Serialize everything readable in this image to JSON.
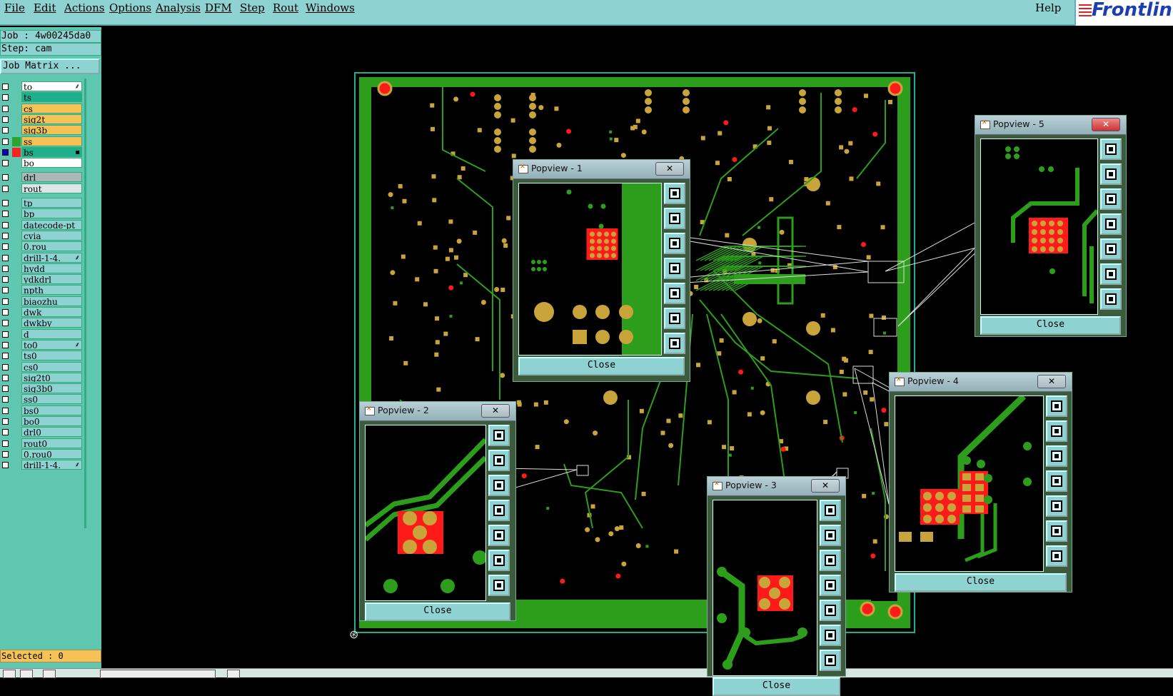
{
  "menu": {
    "items": [
      "File",
      "Edit",
      "Actions",
      "Options",
      "Analysis",
      "DFM",
      "Step",
      "Rout",
      "Windows"
    ],
    "help": "Help",
    "logo": "Frontline"
  },
  "job": {
    "job_label": "Job : 4w00245da0",
    "step_label": "Step: cam",
    "matrix_button": "Job Matrix ..."
  },
  "layers": [
    {
      "name": "to",
      "color": "#ffffff",
      "icon": "⸙"
    },
    {
      "name": "ts",
      "color": "#1fae8e",
      "icon": ""
    },
    {
      "name": "cs",
      "color": "#f6c155",
      "icon": ""
    },
    {
      "name": "sig2t",
      "color": "#f6c155",
      "icon": ""
    },
    {
      "name": "sig3b",
      "color": "#f6c155",
      "icon": ""
    },
    {
      "name": "ss",
      "color": "#f6c155",
      "icon": "",
      "mark": "#2da52d"
    },
    {
      "name": "bs",
      "color": "#1fae8e",
      "icon": "▪",
      "mark": "#ff2020",
      "active": true
    },
    {
      "name": "bo",
      "color": "#ffffff",
      "icon": ""
    },
    {
      "name": "drl",
      "color": "#aab8b8",
      "icon": "",
      "gap": true
    },
    {
      "name": "rout",
      "color": "#dde6e6",
      "icon": ""
    },
    {
      "name": "tp",
      "color": "#8fd2d2",
      "icon": "",
      "gap": true
    },
    {
      "name": "bp",
      "color": "#8fd2d2",
      "icon": ""
    },
    {
      "name": "datecode-pt",
      "color": "#8fd2d2",
      "icon": ""
    },
    {
      "name": "cvia",
      "color": "#8fd2d2",
      "icon": ""
    },
    {
      "name": "0.rou",
      "color": "#8fd2d2",
      "icon": ""
    },
    {
      "name": "drill-1-4.",
      "color": "#8fd2d2",
      "icon": "⸙"
    },
    {
      "name": "hydd",
      "color": "#8fd2d2",
      "icon": ""
    },
    {
      "name": "ydkdrl",
      "color": "#8fd2d2",
      "icon": ""
    },
    {
      "name": "npth",
      "color": "#8fd2d2",
      "icon": ""
    },
    {
      "name": "biaozhu",
      "color": "#8fd2d2",
      "icon": ""
    },
    {
      "name": "dwk",
      "color": "#8fd2d2",
      "icon": ""
    },
    {
      "name": "dwkby",
      "color": "#8fd2d2",
      "icon": ""
    },
    {
      "name": "d",
      "color": "#8fd2d2",
      "icon": ""
    },
    {
      "name": "to0",
      "color": "#8fd2d2",
      "icon": "⸙"
    },
    {
      "name": "ts0",
      "color": "#8fd2d2",
      "icon": ""
    },
    {
      "name": "cs0",
      "color": "#8fd2d2",
      "icon": ""
    },
    {
      "name": "sig2t0",
      "color": "#8fd2d2",
      "icon": ""
    },
    {
      "name": "sig3b0",
      "color": "#8fd2d2",
      "icon": ""
    },
    {
      "name": "ss0",
      "color": "#8fd2d2",
      "icon": ""
    },
    {
      "name": "bs0",
      "color": "#8fd2d2",
      "icon": ""
    },
    {
      "name": "bo0",
      "color": "#8fd2d2",
      "icon": ""
    },
    {
      "name": "drl0",
      "color": "#8fd2d2",
      "icon": ""
    },
    {
      "name": "rout0",
      "color": "#8fd2d2",
      "icon": ""
    },
    {
      "name": "0.rou0",
      "color": "#8fd2d2",
      "icon": ""
    },
    {
      "name": "drill-1-4.",
      "color": "#8fd2d2",
      "icon": "⸙"
    }
  ],
  "status": {
    "selected": "Selected : 0"
  },
  "popviews": [
    {
      "title": "Popview - 1",
      "close": "Close",
      "close_x": "✕"
    },
    {
      "title": "Popview - 2",
      "close": "Close",
      "close_x": "✕"
    },
    {
      "title": "Popview - 3",
      "close": "Close",
      "close_x": "✕"
    },
    {
      "title": "Popview - 4",
      "close": "Close",
      "close_x": "✕"
    },
    {
      "title": "Popview - 5",
      "close": "Close",
      "close_x": "✕"
    }
  ],
  "popview_tools": [
    "zoom-window-icon",
    "pan-up-icon",
    "pan-down-icon",
    "pan-left-icon",
    "pan-right-icon",
    "zoom-out-icon",
    "zoom-home-icon"
  ],
  "colors": {
    "board_green": "#2d9e1c",
    "pad_gold": "#c9a43a",
    "pad_red": "#ff1a1a",
    "panel_teal": "#5fc7b0",
    "menu_teal": "#8fd2d2"
  }
}
